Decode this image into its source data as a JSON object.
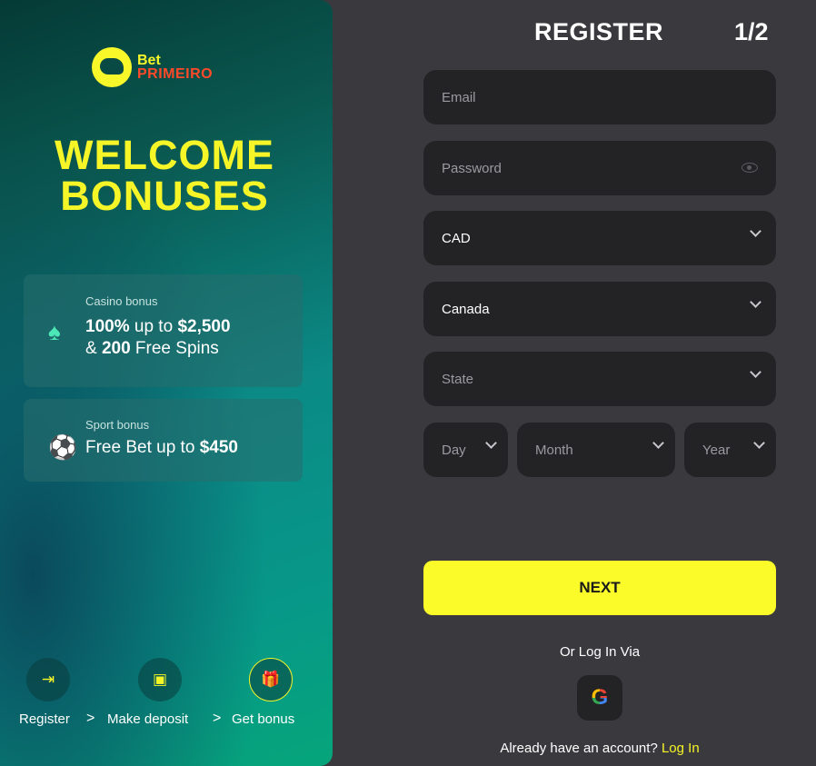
{
  "brand": {
    "line1": "Bet",
    "line2": "PRIMEIRO",
    "accent": "#f5f527",
    "brand_red": "#ff4a2a"
  },
  "promo": {
    "headline_1": "WELCOME",
    "headline_2": "BONUSES",
    "casino": {
      "label": "Casino bonus",
      "icon": "spade-icon",
      "amount_pct": "100%",
      "up_to": " up to ",
      "amount": "$2,500",
      "amp": "& ",
      "spins_count": "200",
      "spins_label": " Free Spins"
    },
    "sport": {
      "label": "Sport bonus",
      "icon": "soccer-ball-icon",
      "prefix": "Free Bet up to ",
      "amount": "$450"
    },
    "steps": [
      {
        "label": "Register",
        "icon": "sign-in-icon"
      },
      {
        "label": "Make deposit",
        "icon": "wallet-icon"
      },
      {
        "label": "Get bonus",
        "icon": "gift-icon"
      }
    ],
    "step_separator": ">"
  },
  "form": {
    "title": "REGISTER",
    "step": "1/2",
    "email_placeholder": "Email",
    "password_placeholder": "Password",
    "currency": "CAD",
    "country": "Canada",
    "state_placeholder": "State",
    "day_placeholder": "Day",
    "month_placeholder": "Month",
    "year_placeholder": "Year",
    "next_label": "NEXT",
    "or_login_via": "Or Log In Via",
    "google_glyph": "G",
    "account_prompt": "Already have an account? ",
    "login_link": "Log In"
  }
}
